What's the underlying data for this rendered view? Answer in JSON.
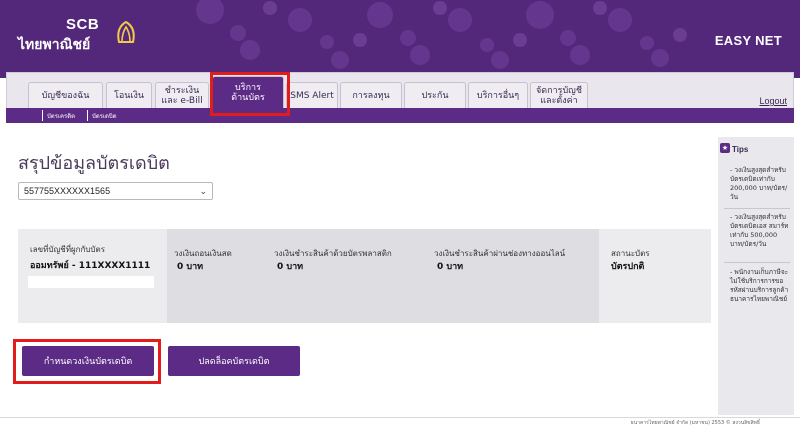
{
  "header": {
    "brand_scb": "SCB",
    "brand_thai": "ไทยพาณิชย์",
    "app_name": "EASY NET"
  },
  "nav": {
    "tabs": [
      {
        "label": "บัญชีของฉัน"
      },
      {
        "label": "โอนเงิน"
      },
      {
        "label": "ชำระเงิน\nและ e-Bill"
      },
      {
        "label": "บริการ\nด้านบัตร"
      },
      {
        "label": "SMS Alert"
      },
      {
        "label": "การลงทุน"
      },
      {
        "label": "ประกัน"
      },
      {
        "label": "บริการอื่นๆ"
      },
      {
        "label": "จัดการบัญชี\nและตั้งค่า"
      }
    ],
    "logout": "Logout",
    "subnav": [
      "บัตรเครดิต",
      "บัตรเดบิต"
    ]
  },
  "main": {
    "title": "สรุปข้อมูลบัตรเดบิต",
    "card_number": "557755XXXXXX1565",
    "account_label": "เลขที่บัญชีที่ผูกกับบัตร",
    "account_value": "ออมทรัพย์ - 111XXXX1111",
    "limits": [
      {
        "label": "วงเงินถอนเงินสด",
        "value": "0 บาท"
      },
      {
        "label": "วงเงินชำระสินค้าด้วยบัตรพลาสติก",
        "value": "0 บาท"
      },
      {
        "label": "วงเงินชำระสินค้าผ่านช่องทางออนไลน์",
        "value": "0 บาท"
      }
    ],
    "status_label": "สถานะบัตร",
    "status_value": "บัตรปกติ",
    "buttons": {
      "set_limit": "กำหนดวงเงินบัตรเดบิต",
      "unlock": "ปลดล็อคบัตรเดบิต"
    }
  },
  "tips": {
    "title": "Tips",
    "items": [
      "- วงเงินสูงสุดสำหรับบัตรเดบิตเท่ากับ 200,000 บาท/บัตร/วัน",
      "- วงเงินสูงสุดสำหรับบัตรเดบิตเอส สมาร์ทเท่ากับ 500,000 บาท/บัตร/วัน",
      "- พนักงานเก็บภาษีจะไม่ใช้บริการการขอรหัสผ่านบริการลูกค้าธนาคารไทยพาณิชย์"
    ]
  },
  "footer": {
    "text": "ธนาคารไทยพาณิชย์ จำกัด (มหาชน) 2553 © สงวนลิขสิทธิ์"
  },
  "colors": {
    "brand_purple": "#5b2b85",
    "highlight_red": "#e21b1b"
  }
}
